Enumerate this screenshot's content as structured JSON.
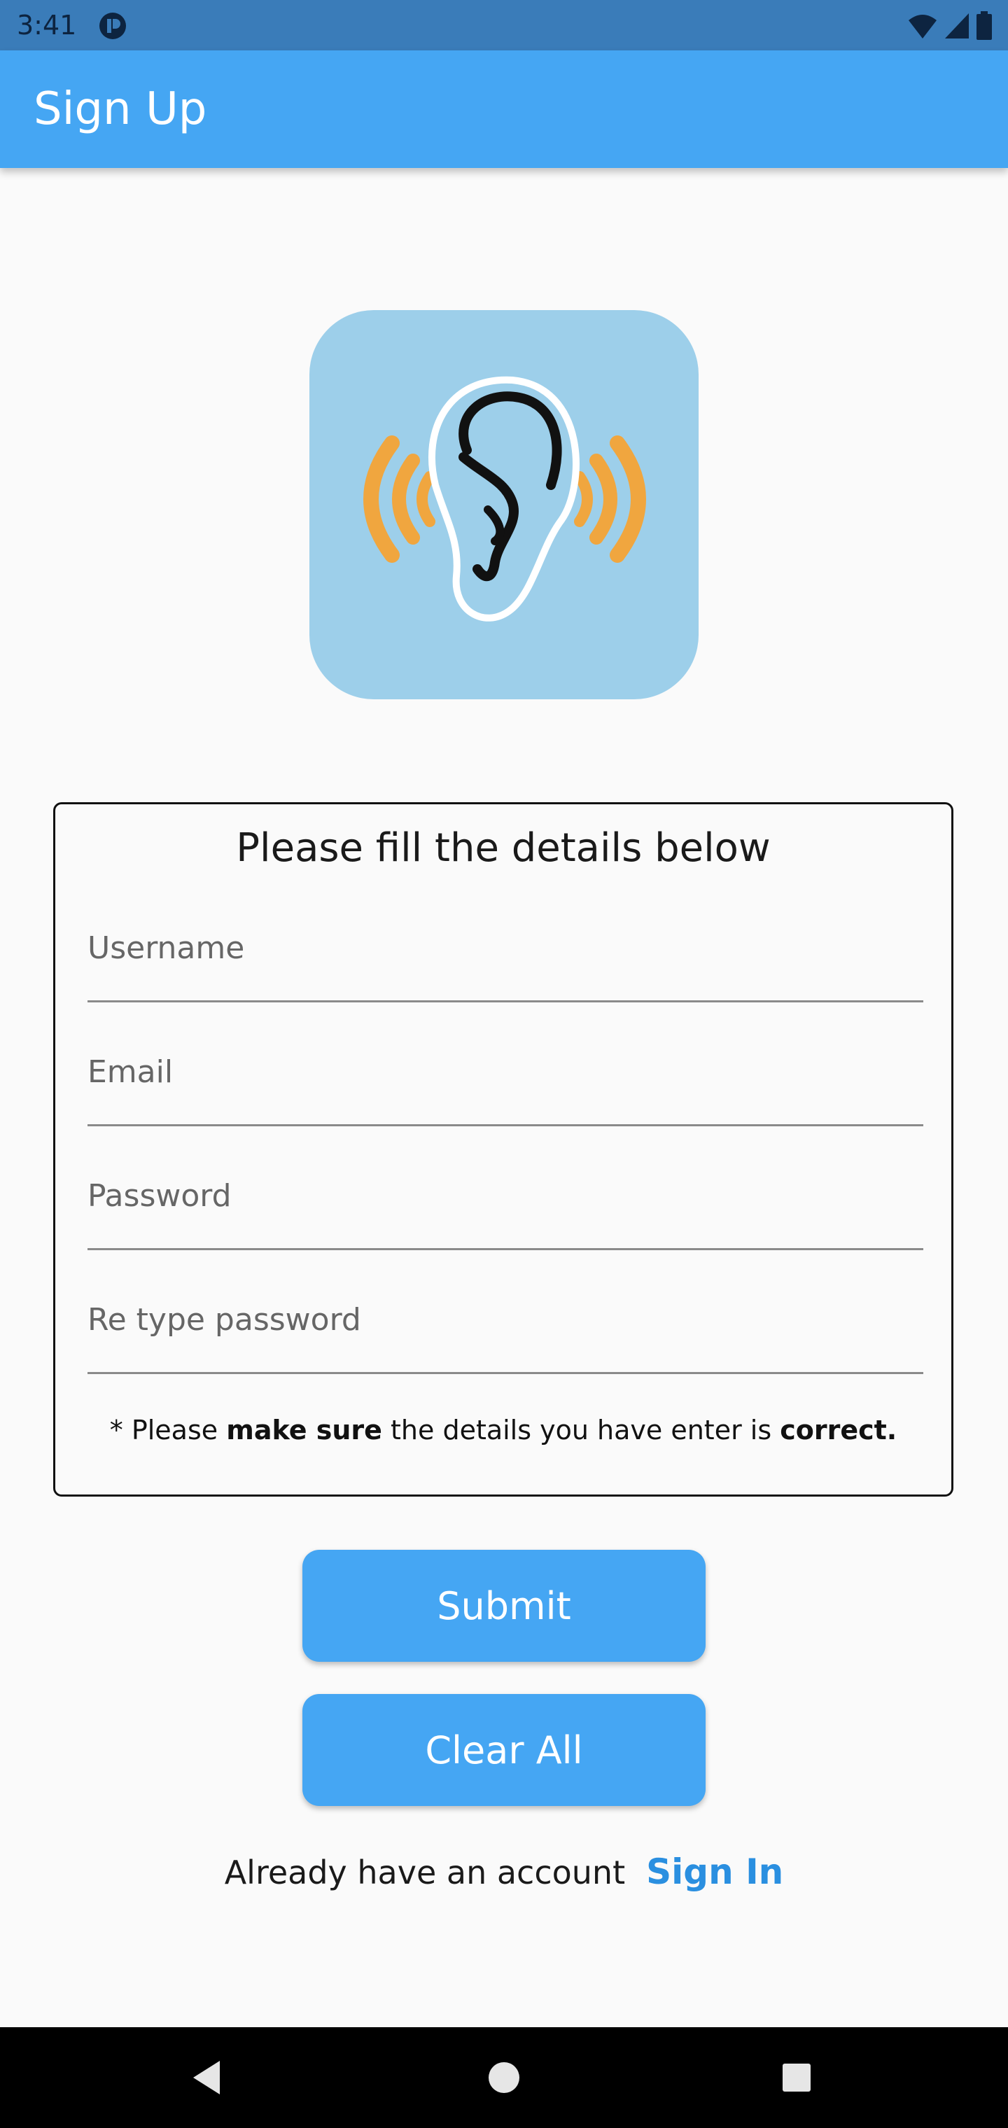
{
  "status_bar": {
    "time": "3:41",
    "icons": [
      "app-notification-icon",
      "wifi-icon",
      "signal-icon",
      "battery-icon"
    ]
  },
  "app_bar": {
    "title": "Sign Up"
  },
  "logo": {
    "icon": "ear-sound-icon",
    "background_color": "#9dcfea",
    "wave_color": "#f0a63f"
  },
  "form": {
    "title": "Please fill the details below",
    "fields": [
      {
        "name": "username",
        "placeholder": "Username",
        "value": ""
      },
      {
        "name": "email",
        "placeholder": "Email",
        "value": ""
      },
      {
        "name": "password",
        "placeholder": "Password",
        "value": ""
      },
      {
        "name": "retype_password",
        "placeholder": "Re type password",
        "value": ""
      }
    ],
    "note": {
      "prefix": "* Please ",
      "bold1": "make sure",
      "middle": " the details you have enter is ",
      "bold2": "correct."
    }
  },
  "buttons": {
    "submit": "Submit",
    "clear_all": "Clear All"
  },
  "signin": {
    "text": "Already have an account",
    "link": "Sign In"
  },
  "nav_bar": {
    "icons": [
      "back-icon",
      "home-icon",
      "recents-icon"
    ]
  },
  "colors": {
    "status_bar": "#3a7cb9",
    "app_bar": "#45a6f3",
    "button": "#45a6f3",
    "link": "#2a8fe0",
    "background": "#fafafa"
  }
}
